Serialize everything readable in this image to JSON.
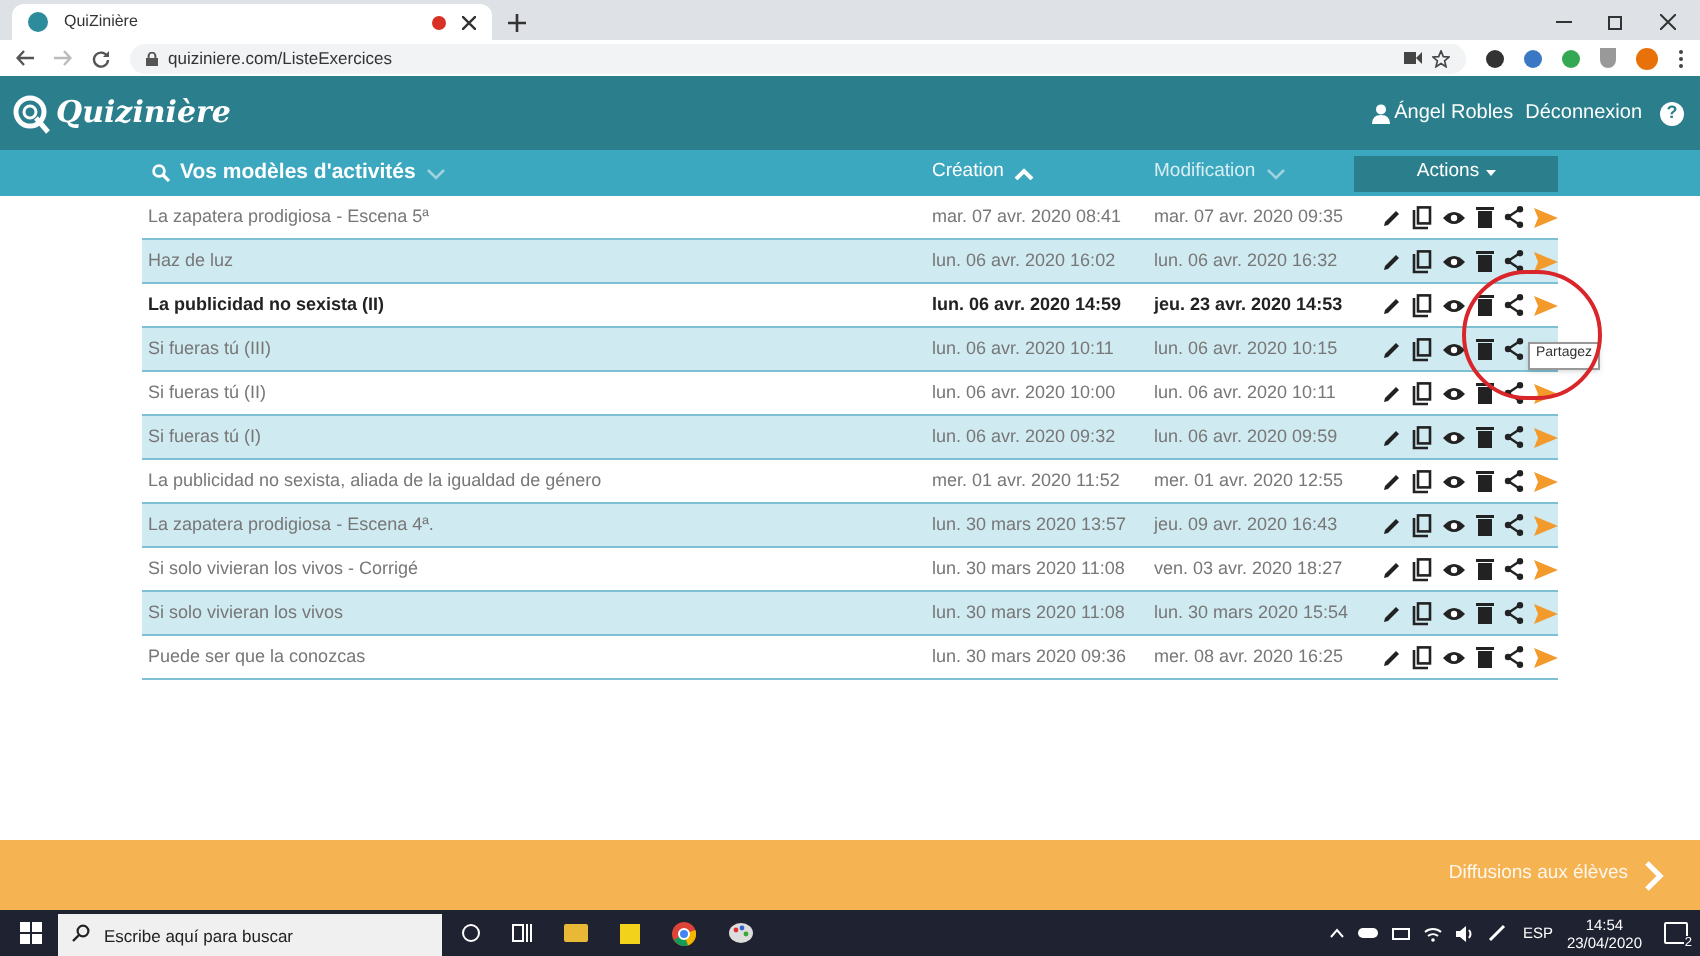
{
  "browser": {
    "tab_title": "QuiZinière",
    "url": "quiziniere.com/ListeExercices"
  },
  "header": {
    "logo": "Quizinière",
    "user": "Ángel Robles",
    "logout": "Déconnexion",
    "help": "?"
  },
  "toolbar": {
    "title": "Vos modèles d'activités",
    "columns": [
      {
        "label": "Création",
        "sort_active": true
      },
      {
        "label": "Modification",
        "sort_active": false
      }
    ],
    "actions": "Actions"
  },
  "rows": [
    {
      "title": "La zapatera prodigiosa - Escena 5ª",
      "created": "mar. 07 avr. 2020 08:41",
      "modified": "mar. 07 avr. 2020 09:35",
      "bold": false
    },
    {
      "title": "Haz de luz",
      "created": "lun. 06 avr. 2020 16:02",
      "modified": "lun. 06 avr. 2020 16:32",
      "bold": false
    },
    {
      "title": "La publicidad no sexista (II)",
      "created": "lun. 06 avr. 2020 14:59",
      "modified": "jeu. 23 avr. 2020 14:53",
      "bold": true
    },
    {
      "title": "Si fueras tú (III)",
      "created": "lun. 06 avr. 2020 10:11",
      "modified": "lun. 06 avr. 2020 10:15",
      "bold": false,
      "tooltip": "Partagez"
    },
    {
      "title": "Si fueras tú (II)",
      "created": "lun. 06 avr. 2020 10:00",
      "modified": "lun. 06 avr. 2020 10:11",
      "bold": false
    },
    {
      "title": "Si fueras tú (I)",
      "created": "lun. 06 avr. 2020 09:32",
      "modified": "lun. 06 avr. 2020 09:59",
      "bold": false
    },
    {
      "title": "La publicidad no sexista, aliada de la igualdad de género",
      "created": "mer. 01 avr. 2020 11:52",
      "modified": "mer. 01 avr. 2020 12:55",
      "bold": false
    },
    {
      "title": "La zapatera prodigiosa - Escena 4ª.",
      "created": "lun. 30 mars 2020 13:57",
      "modified": "jeu. 09 avr. 2020 16:43",
      "bold": false
    },
    {
      "title": "Si solo vivieran los vivos - Corrigé",
      "created": "lun. 30 mars 2020 11:08",
      "modified": "ven. 03 avr. 2020 18:27",
      "bold": false
    },
    {
      "title": "Si solo vivieran los vivos",
      "created": "lun. 30 mars 2020 11:08",
      "modified": "lun. 30 mars 2020 15:54",
      "bold": false
    },
    {
      "title": "Puede ser que la conozcas",
      "created": "lun. 30 mars 2020 09:36",
      "modified": "mer. 08 avr. 2020 16:25",
      "bold": false
    }
  ],
  "annotation_circle": true,
  "footer": {
    "label": "Diffusions aux élèves"
  },
  "taskbar": {
    "search_placeholder": "Escribe aquí para buscar",
    "language": "ESP",
    "time": "14:54",
    "date": "23/04/2020",
    "notifications": "2"
  }
}
